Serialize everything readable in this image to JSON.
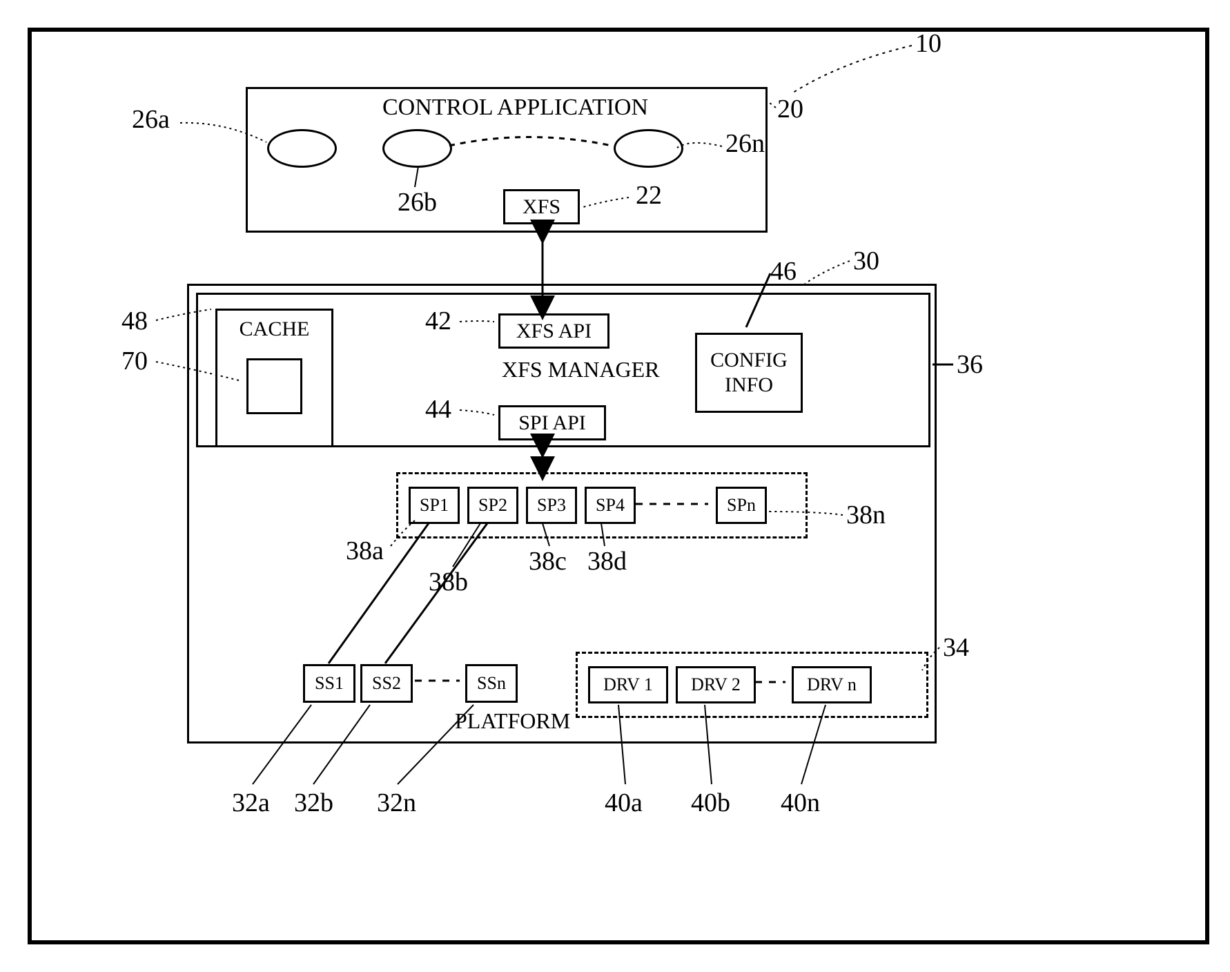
{
  "ref_outer": "10",
  "control_app": {
    "title": "CONTROL APPLICATION",
    "ref": "20",
    "xfs": "XFS",
    "xfs_ref": "22"
  },
  "ovals": {
    "a": "26a",
    "b": "26b",
    "n": "26n"
  },
  "platform": {
    "title": "PLATFORM",
    "ref": "30"
  },
  "xfs_manager": {
    "title": "XFS MANAGER",
    "ref": "36",
    "xfs_api": "XFS API",
    "xfs_api_ref": "42",
    "spi_api": "SPI API",
    "spi_api_ref": "44"
  },
  "cache": {
    "title": "CACHE",
    "ref": "48",
    "inner_ref": "70"
  },
  "config": {
    "title1": "CONFIG",
    "title2": "INFO",
    "ref": "46"
  },
  "sp": {
    "1": "SP1",
    "2": "SP2",
    "3": "SP3",
    "4": "SP4",
    "n": "SPn",
    "ref_a": "38a",
    "ref_b": "38b",
    "ref_c": "38c",
    "ref_d": "38d",
    "ref_n": "38n"
  },
  "ss": {
    "1": "SS1",
    "2": "SS2",
    "n": "SSn",
    "ref_a": "32a",
    "ref_b": "32b",
    "ref_n": "32n"
  },
  "drv": {
    "1": "DRV 1",
    "2": "DRV 2",
    "n": "DRV n",
    "ref_a": "40a",
    "ref_b": "40b",
    "ref_n": "40n",
    "group_ref": "34"
  }
}
